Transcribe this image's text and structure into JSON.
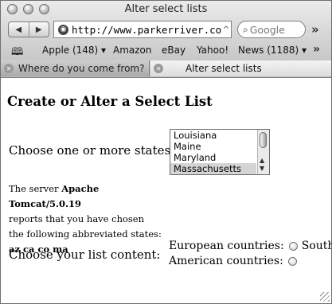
{
  "window": {
    "title": "Alter select lists"
  },
  "toolbar": {
    "back_glyph": "◀",
    "forward_glyph": "▶",
    "url": "http://www.parkerriver.com/ajax",
    "url_dropdown_glyph": "^",
    "search_placeholder": "Google",
    "overflow_glyph": "»"
  },
  "bookmarks": {
    "items": [
      {
        "label": "Apple (148) ▾"
      },
      {
        "label": "Amazon"
      },
      {
        "label": "eBay"
      },
      {
        "label": "Yahoo!"
      },
      {
        "label": "News (1188) ▾"
      }
    ],
    "overflow_glyph": "»"
  },
  "tabs": [
    {
      "label": "Where do you come from?",
      "active": false
    },
    {
      "label": "Alter select lists",
      "active": true
    }
  ],
  "page": {
    "heading": "Create or Alter a Select List",
    "states_label": "Choose one or more states:",
    "states_options": [
      {
        "label": "Louisiana",
        "selected": false
      },
      {
        "label": "Maine",
        "selected": false
      },
      {
        "label": "Maryland",
        "selected": false
      },
      {
        "label": "Massachusetts",
        "selected": true
      }
    ],
    "result": {
      "line1_prefix": "The server ",
      "server_name": "Apache Tomcat/5.0.19",
      "line2": "reports that you have chosen",
      "line3_prefix": "the following abbreviated states: ",
      "states_abbrev": "az ca co ma"
    },
    "content_label": "Choose your list content:",
    "radio_options": [
      {
        "label": "European countries:",
        "suffix": "South",
        "checked": false
      },
      {
        "label": "American countries:",
        "suffix": "",
        "checked": false
      }
    ]
  }
}
